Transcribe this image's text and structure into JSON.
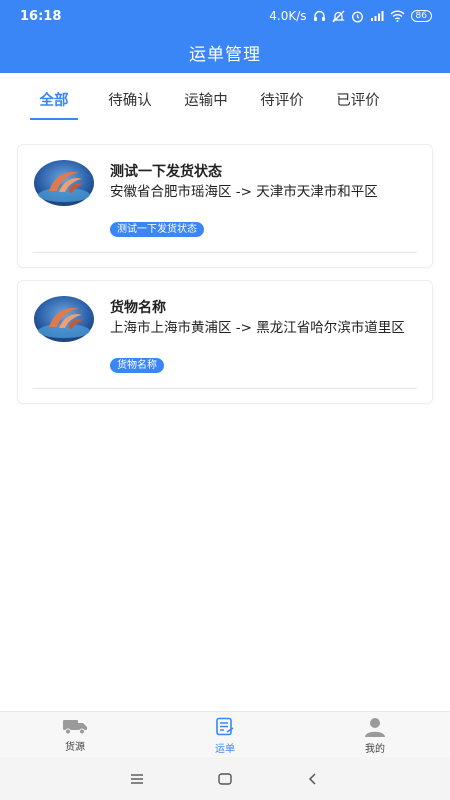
{
  "status_bar": {
    "time": "16:18",
    "speed": "4.0K/s",
    "battery": "86"
  },
  "header": {
    "title": "运单管理"
  },
  "tabs": [
    {
      "label": "全部",
      "active": true
    },
    {
      "label": "待确认",
      "active": false
    },
    {
      "label": "运输中",
      "active": false
    },
    {
      "label": "待评价",
      "active": false
    },
    {
      "label": "已评价",
      "active": false
    }
  ],
  "orders": [
    {
      "title": "测试一下发货状态",
      "route": "安徽省合肥市瑶海区 -> 天津市天津市和平区",
      "tag": "测试一下发货状态"
    },
    {
      "title": "货物名称",
      "route": "上海市上海市黄浦区 -> 黑龙江省哈尔滨市道里区",
      "tag": "货物名称"
    }
  ],
  "bottom_nav": [
    {
      "label": "货源",
      "icon": "truck-icon",
      "active": false
    },
    {
      "label": "运单",
      "icon": "waybill-icon",
      "active": true
    },
    {
      "label": "我的",
      "icon": "user-icon",
      "active": false
    }
  ],
  "colors": {
    "primary": "#3b86f6"
  }
}
